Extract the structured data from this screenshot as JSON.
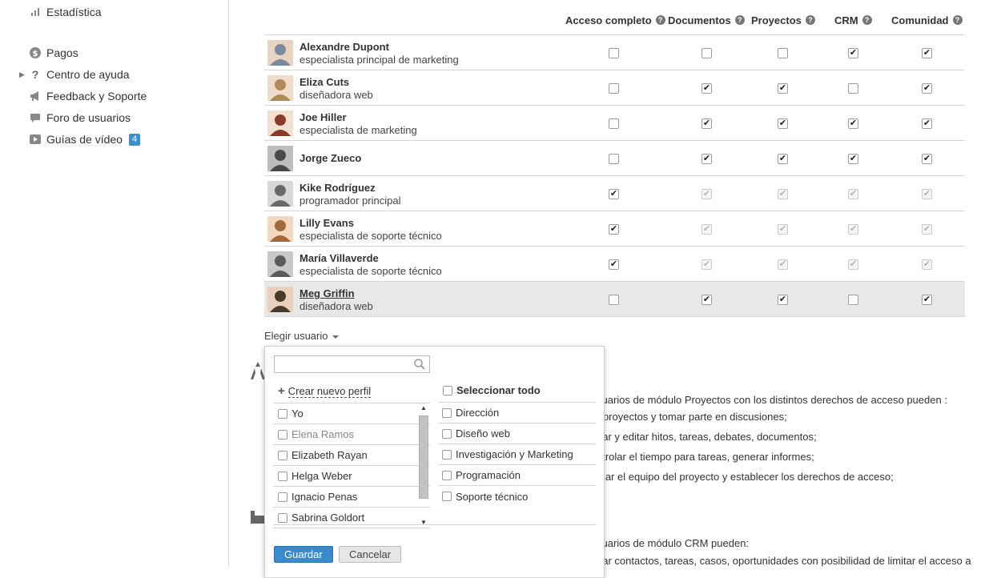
{
  "sidebar": {
    "items": [
      {
        "label": "Estadística",
        "icon": "bar-chart-icon"
      },
      {
        "label": "Pagos",
        "icon": "dollar-icon"
      },
      {
        "label": "Centro de ayuda",
        "icon": "question-icon"
      },
      {
        "label": "Feedback y Soporte",
        "icon": "megaphone-icon"
      },
      {
        "label": "Foro de usuarios",
        "icon": "chat-icon"
      },
      {
        "label": "Guías de vídeo",
        "icon": "video-icon",
        "badge": "4"
      }
    ]
  },
  "columns": [
    "Acceso completo",
    "Documentos",
    "Proyectos",
    "CRM",
    "Comunidad"
  ],
  "users": [
    {
      "name": "Alexandre Dupont",
      "role": "especialista principal de marketing",
      "perms": [
        false,
        false,
        false,
        true,
        true
      ],
      "full": false
    },
    {
      "name": "Eliza Cuts",
      "role": "diseñadora web",
      "perms": [
        false,
        true,
        true,
        false,
        true
      ],
      "full": false
    },
    {
      "name": "Joe Hiller",
      "role": "especialista de marketing",
      "perms": [
        false,
        true,
        true,
        true,
        true
      ],
      "full": false
    },
    {
      "name": "Jorge Zueco",
      "role": "",
      "perms": [
        false,
        true,
        true,
        true,
        true
      ],
      "full": false
    },
    {
      "name": "Kike Rodríguez",
      "role": "programador principal",
      "perms": [
        true,
        true,
        true,
        true,
        true
      ],
      "full": true
    },
    {
      "name": "Lilly Evans",
      "role": "especialista de soporte técnico",
      "perms": [
        true,
        true,
        true,
        true,
        true
      ],
      "full": true
    },
    {
      "name": "María Villaverde",
      "role": "especialista de soporte técnico",
      "perms": [
        true,
        true,
        true,
        true,
        true
      ],
      "full": true
    },
    {
      "name": "Meg Griffin",
      "role": "diseñadora web",
      "perms": [
        false,
        true,
        true,
        false,
        true
      ],
      "full": false,
      "highlight": true
    }
  ],
  "choose_user": "Elegir usuario",
  "background_text": [
    "suarios de módulo Proyectos con los distintos derechos de acceso pueden :",
    "r proyectos y tomar parte en discusiones;",
    "ear y editar hitos, tareas, debates, documentos;",
    "ntrolar el tiempo para tareas, generar informes;",
    "mar el equipo del proyecto y establecer los derechos de acceso;",
    "suarios de módulo CRM pueden:",
    "ear contactos, tareas, casos, oportunidades con posibilidad de limitar el acceso a"
  ],
  "dropdown": {
    "search_value": "",
    "create_profile": "Crear nuevo perfil",
    "select_all": "Seleccionar todo",
    "people": [
      {
        "label": "Yo",
        "muted": false
      },
      {
        "label": "Elena Ramos",
        "muted": true
      },
      {
        "label": "Elizabeth Rayan",
        "muted": false
      },
      {
        "label": "Helga Weber",
        "muted": false
      },
      {
        "label": "Ignacio Penas",
        "muted": false
      },
      {
        "label": "Sabrina Goldort",
        "muted": false
      }
    ],
    "groups": [
      "Dirección",
      "Diseño web",
      "Investigación y Marketing",
      "Programación",
      "Soporte técnico"
    ],
    "save": "Guardar",
    "cancel": "Cancelar"
  },
  "colors": {
    "accent": "#3a8ad0",
    "badge": "#3d8fc7",
    "row_highlight": "#e8e8e8"
  }
}
